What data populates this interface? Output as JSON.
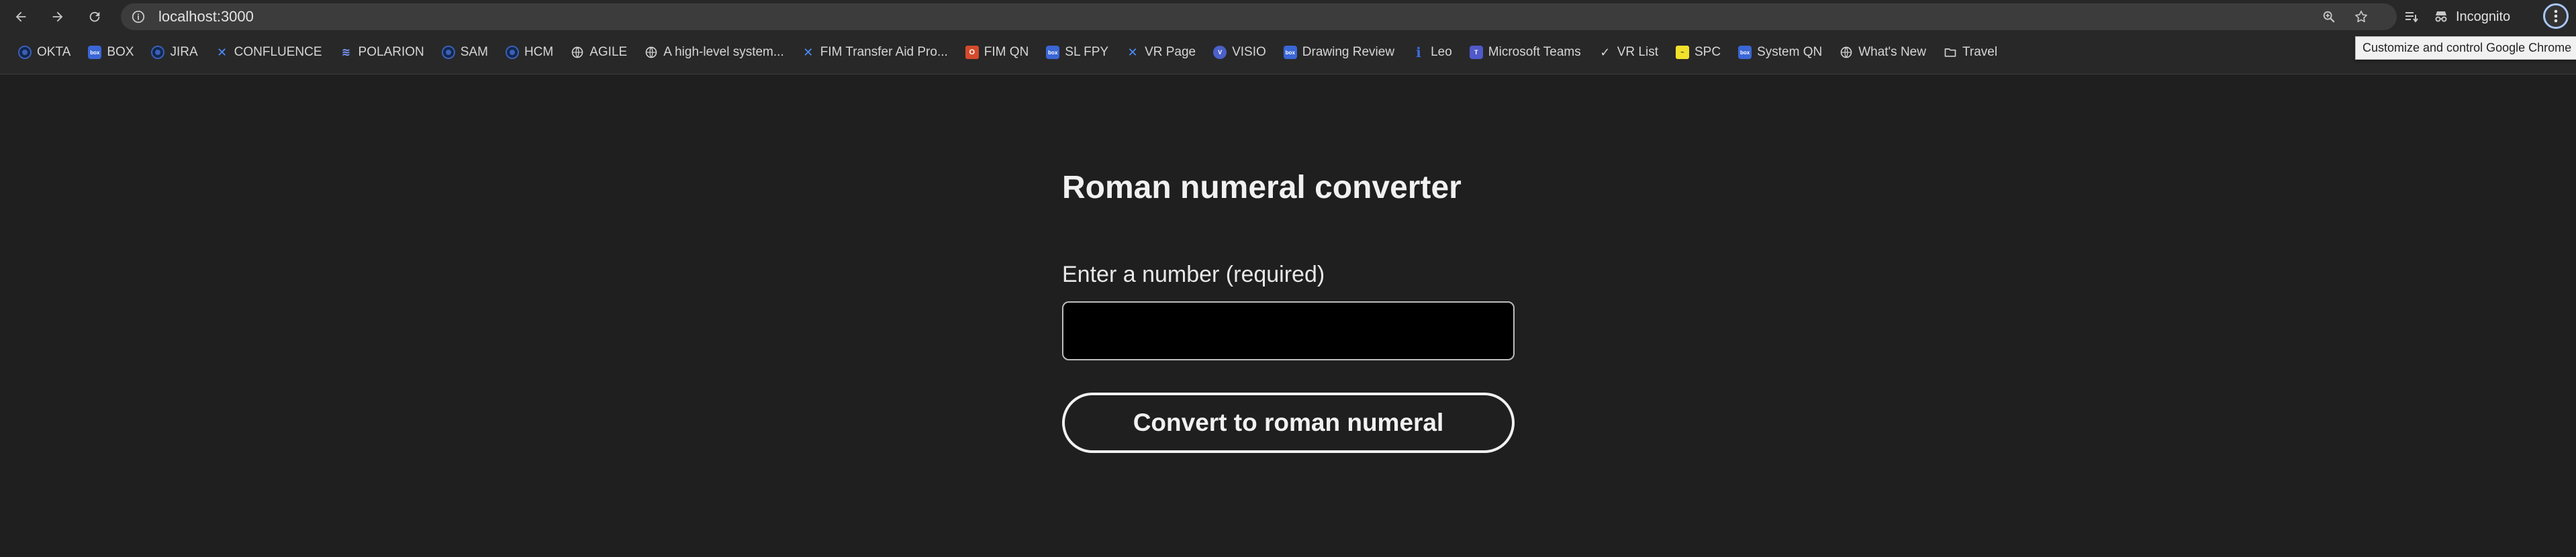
{
  "browser": {
    "url": "localhost:3000",
    "profile_label": "Incognito",
    "menu_tooltip": "Customize and control Google Chrome",
    "icons": {
      "back": "arrow-left-icon",
      "forward": "arrow-right-icon",
      "reload": "reload-icon",
      "site_info": "info-circle-icon",
      "zoom": "magnifier-zoom-icon",
      "bookmark": "star-icon",
      "reading_list": "reading-list-icon",
      "incognito": "incognito-icon",
      "menu": "kebab-menu-icon"
    }
  },
  "bookmarks": [
    {
      "label": "OKTA",
      "icon": "okta-icon"
    },
    {
      "label": "BOX",
      "icon": "box-icon"
    },
    {
      "label": "JIRA",
      "icon": "okta-icon"
    },
    {
      "label": "CONFLUENCE",
      "icon": "confluence-icon"
    },
    {
      "label": "POLARION",
      "icon": "polarion-icon"
    },
    {
      "label": "SAM",
      "icon": "okta-icon"
    },
    {
      "label": "HCM",
      "icon": "okta-icon"
    },
    {
      "label": "AGILE",
      "icon": "globe-icon"
    },
    {
      "label": "A high-level system...",
      "icon": "globe-icon"
    },
    {
      "label": "FIM Transfer Aid Pro...",
      "icon": "confluence-icon"
    },
    {
      "label": "FIM QN",
      "icon": "office-icon"
    },
    {
      "label": "SL FPY",
      "icon": "box-icon"
    },
    {
      "label": "VR Page",
      "icon": "confluence-icon"
    },
    {
      "label": "VISIO",
      "icon": "visio-icon"
    },
    {
      "label": "Drawing Review",
      "icon": "box-icon"
    },
    {
      "label": "Leo",
      "icon": "leo-icon"
    },
    {
      "label": "Microsoft Teams",
      "icon": "teams-icon"
    },
    {
      "label": "VR List",
      "icon": "check-icon"
    },
    {
      "label": "SPC",
      "icon": "spc-icon"
    },
    {
      "label": "System QN",
      "icon": "box-icon"
    },
    {
      "label": "What's New",
      "icon": "globe-icon"
    },
    {
      "label": "Travel",
      "icon": "folder-icon"
    }
  ],
  "page": {
    "title": "Roman numeral converter",
    "input_label": "Enter a number (required)",
    "input_value": "",
    "button_label": "Convert to roman numeral"
  },
  "colors": {
    "background": "#1f1f1f",
    "chrome_bar": "#282828",
    "omnibox": "#3c3c3c",
    "focus_ring": "#a8c7fa",
    "input_bg": "#000000"
  }
}
